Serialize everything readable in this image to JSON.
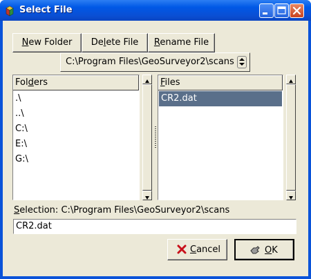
{
  "window": {
    "title": "Select File"
  },
  "titlebar_buttons": {
    "minimize": "minimize",
    "maximize": "maximize",
    "close": "close"
  },
  "toolbar": {
    "new_folder": {
      "prefix": "",
      "accel": "N",
      "rest": "ew Folder"
    },
    "delete_file": {
      "prefix": "De",
      "accel": "l",
      "rest": "ete File"
    },
    "rename_file": {
      "prefix": "",
      "accel": "R",
      "rest": "ename File"
    }
  },
  "path_combo": {
    "value": "C:\\Program Files\\GeoSurveyor2\\scans"
  },
  "folders": {
    "header_prefix": "Fol",
    "header_accel": "d",
    "header_rest": "ers",
    "items": [
      ".\\",
      "..\\",
      "C:\\",
      "E:\\",
      "G:\\"
    ]
  },
  "files": {
    "header_prefix": "",
    "header_accel": "F",
    "header_rest": "iles",
    "items": [
      "CR2.dat"
    ],
    "selected_index": 0
  },
  "selection": {
    "label_prefix": "",
    "label_accel": "S",
    "label_rest": "election:",
    "path": "C:\\Program Files\\GeoSurveyor2\\scans",
    "value": "CR2.dat"
  },
  "actions": {
    "cancel": {
      "prefix": "",
      "accel": "C",
      "rest": "ancel"
    },
    "ok": {
      "prefix": "",
      "accel": "O",
      "rest": "K"
    }
  },
  "colors": {
    "titlebar": "#0058e6",
    "face": "#ece9d8",
    "selection": "#5a6f8a"
  }
}
